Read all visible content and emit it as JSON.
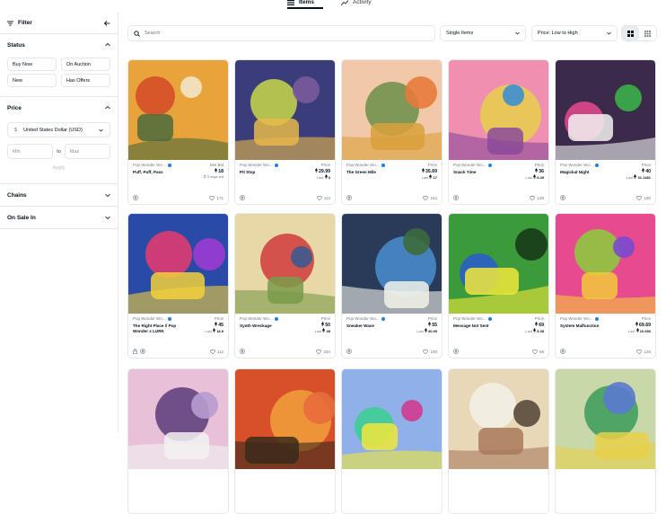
{
  "tabs": [
    {
      "label": "Items",
      "active": true
    },
    {
      "label": "Activity",
      "active": false
    }
  ],
  "sidebar": {
    "filter_label": "Filter",
    "status": {
      "title": "Status",
      "options": [
        "Buy Now",
        "On Auction",
        "New",
        "Has Offers"
      ]
    },
    "price": {
      "title": "Price",
      "currency_symbol": "$",
      "currency": "United States Dollar (USD)",
      "min_placeholder": "Min",
      "to_label": "to",
      "max_placeholder": "Max",
      "apply_label": "Apply"
    },
    "chains_label": "Chains",
    "on_sale_label": "On Sale In"
  },
  "toolbar": {
    "search_placeholder": "Search",
    "items_filter": "Single Items",
    "sort": "Price: Low to High"
  },
  "cards": [
    {
      "collection": "Pop Wonder Wo...",
      "title": "Puff, Puff, Pass",
      "price_label": "Min Bid",
      "price": "18",
      "last": "",
      "sub": "3 days left",
      "likes": "171",
      "icons": [
        "eth"
      ]
    },
    {
      "collection": "Pop Wonder Wo...",
      "title": "Pit Stop",
      "price_label": "Price",
      "price": "29.99",
      "last_label": "Last",
      "last": "3",
      "likes": "113",
      "icons": [
        "eth"
      ]
    },
    {
      "collection": "Pop Wonder Wo...",
      "title": "The Green Mile",
      "price_label": "Price",
      "price": "35.69",
      "last_label": "Last",
      "last": "17",
      "likes": "164",
      "icons": [
        "eth"
      ]
    },
    {
      "collection": "Pop Wonder Wo...",
      "title": "Snack Time",
      "price_label": "Price",
      "price": "36",
      "last_label": "Last",
      "last": "6.49",
      "likes": "139",
      "icons": [
        "eth"
      ]
    },
    {
      "collection": "Pop Wonder Wo...",
      "title": "Magickal Night",
      "price_label": "Price",
      "price": "40",
      "last_label": "Last",
      "last": "31.1481",
      "likes": "180",
      "icons": [
        "eth"
      ]
    },
    {
      "collection": "Pop Wonder Wo...",
      "title": "The Right Place // Pop Wonder x LURK",
      "price_label": "Price",
      "price": "45",
      "last_label": "Last",
      "last": "18.9",
      "likes": "112",
      "icons": [
        "lock",
        "eth"
      ]
    },
    {
      "collection": "Pop Wonder Wo...",
      "title": "Synth Wreckage",
      "price_label": "Price",
      "price": "50",
      "last_label": "Last",
      "last": "38",
      "likes": "234",
      "icons": [
        "eth"
      ]
    },
    {
      "collection": "Pop Wonder Wo...",
      "title": "Sneaker Wave",
      "price_label": "Price",
      "price": "55",
      "last_label": "Last",
      "last": "40.99",
      "likes": "150",
      "icons": [
        "eth"
      ]
    },
    {
      "collection": "Pop Wonder Wo...",
      "title": "Message Not Sent",
      "price_label": "Price",
      "price": "69",
      "last_label": "Last",
      "last": "5.38",
      "likes": "98",
      "icons": [
        "eth"
      ]
    },
    {
      "collection": "Pop Wonder Wo...",
      "title": "System Malfunction",
      "price_label": "Price",
      "price": "69.69",
      "last_label": "Last",
      "last": "10.690",
      "likes": "126",
      "icons": [
        "eth"
      ]
    }
  ],
  "colors": {
    "accent": "#2081e2",
    "border": "#e5e8eb",
    "text": "#04111d",
    "muted": "#707a83"
  }
}
